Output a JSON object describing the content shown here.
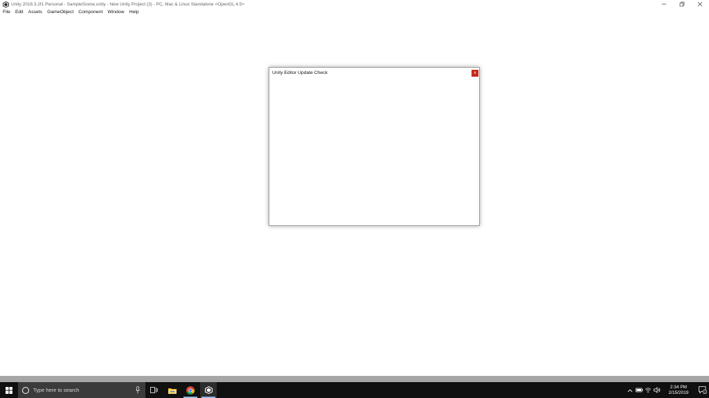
{
  "window": {
    "title": "Unity 2018.3.2f1 Personal - SampleScene.unity - New Unity Project (3) - PC, Mac & Linux Standalone <OpenGL 4.5>",
    "controls": [
      "minimize-icon",
      "restore-icon",
      "close-icon"
    ]
  },
  "menu": {
    "items": [
      "File",
      "Edit",
      "Assets",
      "GameObject",
      "Component",
      "Window",
      "Help"
    ]
  },
  "dialog": {
    "title": "Unity Editor Update Check",
    "close_label": "x",
    "close_color": "#c42b1c"
  },
  "taskbar": {
    "search_placeholder": "Type here to search",
    "pinned": [
      "task-view-icon",
      "file-explorer-icon",
      "chrome-icon",
      "unity-icon"
    ],
    "tray_icons": [
      "chevron-up-icon",
      "battery-icon",
      "network-icon",
      "volume-icon"
    ],
    "clock": {
      "time": "2:34 PM",
      "date": "2/15/2019"
    },
    "notification_count": "1"
  }
}
